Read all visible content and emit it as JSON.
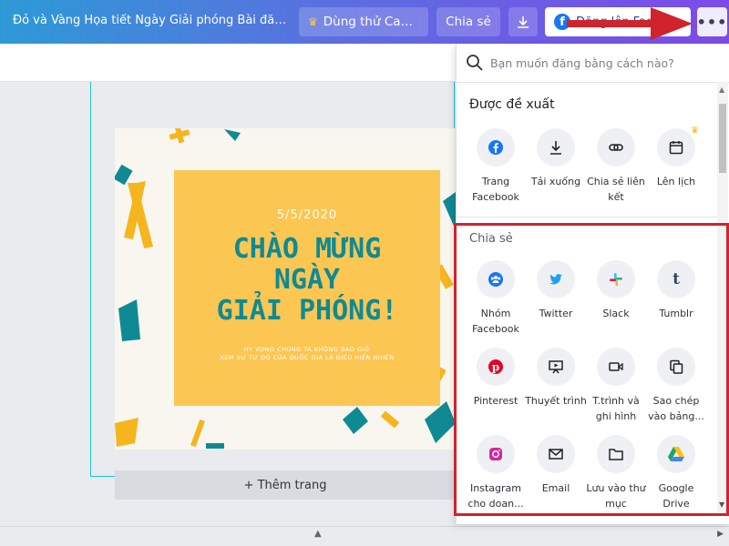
{
  "header": {
    "title": "Đỏ và Vàng Họa tiết Ngày Giải phóng Bài đăng F...",
    "try_button": "Dùng thử Canv...",
    "share_button": "Chia sẻ",
    "facebook_button": "Đăng lên Faceb",
    "more_icon": "more-horizontal-icon"
  },
  "canvas": {
    "date": "5/5/2020",
    "headline": [
      "CHÀO MỪNG",
      "NGÀY",
      "GIẢI PHÓNG!"
    ],
    "subtext": [
      "HY VỌNG CHÚNG TA KHÔNG BAO GIỜ",
      "XEM SỰ TỰ DO CỦA QUỐC GIA LÀ ĐIỀU HIỂN NHIÊN"
    ],
    "add_page": "+ Thêm trang"
  },
  "panel": {
    "search_placeholder": "Bạn muốn đăng bằng cách nào?",
    "suggested_title": "Được đề xuất",
    "suggested": [
      {
        "label": "Trang Facebook",
        "icon": "facebook-icon"
      },
      {
        "label": "Tải xuống",
        "icon": "download-icon"
      },
      {
        "label": "Chia sẻ liên kết",
        "icon": "link-icon"
      },
      {
        "label": "Lên lịch",
        "icon": "calendar-icon"
      }
    ],
    "share_title": "Chia sẻ",
    "share": [
      {
        "label": "Nhóm Facebook",
        "icon": "facebook-group-icon"
      },
      {
        "label": "Twitter",
        "icon": "twitter-icon"
      },
      {
        "label": "Slack",
        "icon": "slack-icon"
      },
      {
        "label": "Tumblr",
        "icon": "tumblr-icon"
      },
      {
        "label": "Pinterest",
        "icon": "pinterest-icon"
      },
      {
        "label": "Thuyết trình",
        "icon": "presentation-icon"
      },
      {
        "label": "T.trình và ghi hình",
        "icon": "video-record-icon"
      },
      {
        "label": "Sao chép vào bảng...",
        "icon": "copy-icon"
      },
      {
        "label": "Instagram cho doan...",
        "icon": "instagram-icon"
      },
      {
        "label": "Email",
        "icon": "email-icon"
      },
      {
        "label": "Lưu vào thư mục",
        "icon": "folder-icon"
      },
      {
        "label": "Google Drive",
        "icon": "google-drive-icon"
      }
    ]
  },
  "colors": {
    "facebook": "#1877f2",
    "highlight": "#d0232d",
    "poster_yellow": "#fcc652",
    "headline_teal": "#0f8a93"
  }
}
